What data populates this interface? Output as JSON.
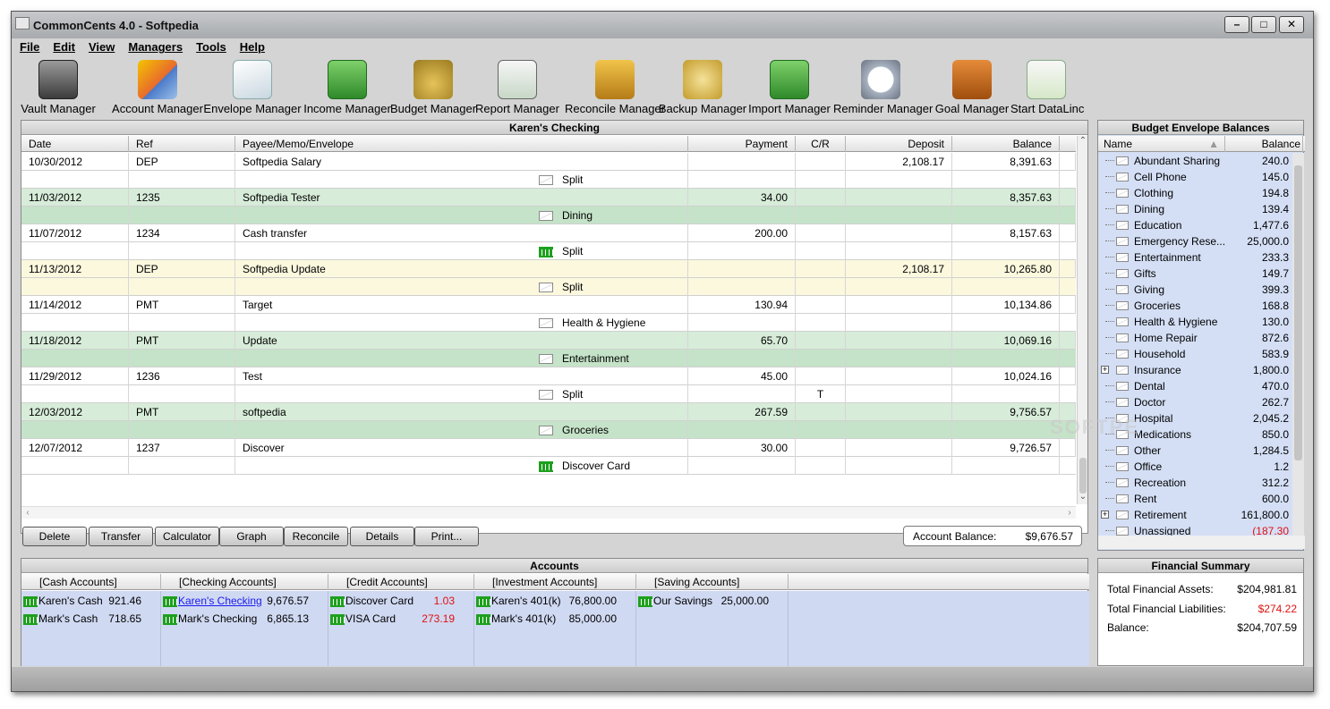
{
  "window": {
    "title": "CommonCents 4.0 - Softpedia"
  },
  "menu": [
    "File",
    "Edit",
    "View",
    "Managers",
    "Tools",
    "Help"
  ],
  "toolbar": [
    {
      "label": "Vault Manager",
      "icon": "vault-icon"
    },
    {
      "label": "Account Manager",
      "icon": "account-icon"
    },
    {
      "label": "Envelope Manager",
      "icon": "envelope-icon"
    },
    {
      "label": "Income Manager",
      "icon": "money-icon"
    },
    {
      "label": "Budget Manager",
      "icon": "money-bag-icon"
    },
    {
      "label": "Report Manager",
      "icon": "report-icon"
    },
    {
      "label": "Reconcile Manager",
      "icon": "scales-icon"
    },
    {
      "label": "Backup Manager",
      "icon": "coins-icon"
    },
    {
      "label": "Import Manager",
      "icon": "import-icon"
    },
    {
      "label": "Reminder Manager",
      "icon": "clock-icon"
    },
    {
      "label": "Goal Manager",
      "icon": "abacus-icon"
    },
    {
      "label": "Start DataLinc",
      "icon": "datalinc-icon"
    }
  ],
  "register": {
    "title": "Karen's Checking",
    "columns": {
      "date": "Date",
      "ref": "Ref",
      "payee": "Payee/Memo/Envelope",
      "payment": "Payment",
      "cr": "C/R",
      "deposit": "Deposit",
      "balance": "Balance"
    },
    "rows": [
      {
        "date": "10/30/2012",
        "ref": "DEP",
        "payee": "Softpedia Salary",
        "payment": "",
        "deposit": "2,108.17",
        "balance": "8,391.63",
        "envelope": "Split",
        "icon": "envelope",
        "cr": "",
        "style": "white"
      },
      {
        "date": "11/03/2012",
        "ref": "1235",
        "payee": "Softpedia Tester",
        "payment": "34.00",
        "deposit": "",
        "balance": "8,357.63",
        "envelope": "Dining",
        "icon": "envelope",
        "cr": "",
        "style": "green"
      },
      {
        "date": "11/07/2012",
        "ref": "1234",
        "payee": "Cash transfer",
        "payment": "200.00",
        "deposit": "",
        "balance": "8,157.63",
        "envelope": "Split",
        "icon": "bank",
        "cr": "",
        "style": "white"
      },
      {
        "date": "11/13/2012",
        "ref": "DEP",
        "payee": "Softpedia Update",
        "payment": "",
        "deposit": "2,108.17",
        "balance": "10,265.80",
        "envelope": "Split",
        "icon": "envelope",
        "cr": "",
        "style": "yellow"
      },
      {
        "date": "11/14/2012",
        "ref": "PMT",
        "payee": "Target",
        "payment": "130.94",
        "deposit": "",
        "balance": "10,134.86",
        "envelope": "Health & Hygiene",
        "icon": "envelope",
        "cr": "",
        "style": "white"
      },
      {
        "date": "11/18/2012",
        "ref": "PMT",
        "payee": "Update",
        "payment": "65.70",
        "deposit": "",
        "balance": "10,069.16",
        "envelope": "Entertainment",
        "icon": "envelope",
        "cr": "",
        "style": "green"
      },
      {
        "date": "11/29/2012",
        "ref": "1236",
        "payee": "Test",
        "payment": "45.00",
        "deposit": "",
        "balance": "10,024.16",
        "envelope": "Split",
        "icon": "envelope",
        "cr": "T",
        "style": "white"
      },
      {
        "date": "12/03/2012",
        "ref": "PMT",
        "payee": "softpedia",
        "payment": "267.59",
        "deposit": "",
        "balance": "9,756.57",
        "envelope": "Groceries",
        "icon": "envelope",
        "cr": "",
        "style": "green"
      },
      {
        "date": "12/07/2012",
        "ref": "1237",
        "payee": "Discover",
        "payment": "30.00",
        "deposit": "",
        "balance": "9,726.57",
        "envelope": "Discover Card",
        "icon": "bank",
        "cr": "",
        "style": "white"
      }
    ],
    "buttons": [
      "Delete",
      "Transfer",
      "Calculator",
      "Graph",
      "Reconcile",
      "Details",
      "Print..."
    ],
    "account_balance_label": "Account Balance:",
    "account_balance_value": "$9,676.57"
  },
  "envelopes": {
    "title": "Budget Envelope Balances",
    "col_name": "Name",
    "col_balance": "Balance",
    "items": [
      {
        "name": "Abundant Sharing",
        "balance": "240.0",
        "neg": false,
        "expand": false
      },
      {
        "name": "Cell Phone",
        "balance": "145.0",
        "neg": false,
        "expand": false
      },
      {
        "name": "Clothing",
        "balance": "194.8",
        "neg": false,
        "expand": false
      },
      {
        "name": "Dining",
        "balance": "139.4",
        "neg": false,
        "expand": false
      },
      {
        "name": "Education",
        "balance": "1,477.6",
        "neg": false,
        "expand": false
      },
      {
        "name": "Emergency Rese...",
        "balance": "25,000.0",
        "neg": false,
        "expand": false
      },
      {
        "name": "Entertainment",
        "balance": "233.3",
        "neg": false,
        "expand": false
      },
      {
        "name": "Gifts",
        "balance": "149.7",
        "neg": false,
        "expand": false
      },
      {
        "name": "Giving",
        "balance": "399.3",
        "neg": false,
        "expand": false
      },
      {
        "name": "Groceries",
        "balance": "168.8",
        "neg": false,
        "expand": false
      },
      {
        "name": "Health & Hygiene",
        "balance": "130.0",
        "neg": false,
        "expand": false
      },
      {
        "name": "Home Repair",
        "balance": "872.6",
        "neg": false,
        "expand": false
      },
      {
        "name": "Household",
        "balance": "583.9",
        "neg": false,
        "expand": false
      },
      {
        "name": "Insurance",
        "balance": "1,800.0",
        "neg": false,
        "expand": true
      },
      {
        "name": "Dental",
        "balance": "470.0",
        "neg": false,
        "expand": false
      },
      {
        "name": "Doctor",
        "balance": "262.7",
        "neg": false,
        "expand": false
      },
      {
        "name": "Hospital",
        "balance": "2,045.2",
        "neg": false,
        "expand": false
      },
      {
        "name": "Medications",
        "balance": "850.0",
        "neg": false,
        "expand": false
      },
      {
        "name": "Other",
        "balance": "1,284.5",
        "neg": false,
        "expand": false
      },
      {
        "name": "Office",
        "balance": "1.2",
        "neg": false,
        "expand": false
      },
      {
        "name": "Recreation",
        "balance": "312.2",
        "neg": false,
        "expand": false
      },
      {
        "name": "Rent",
        "balance": "600.0",
        "neg": false,
        "expand": false
      },
      {
        "name": "Retirement",
        "balance": "161,800.0",
        "neg": false,
        "expand": true
      },
      {
        "name": "Unassigned",
        "balance": "(187.30",
        "neg": true,
        "expand": false
      }
    ]
  },
  "accounts": {
    "title": "Accounts",
    "groups": [
      {
        "header": "[Cash Accounts]",
        "items": [
          {
            "name": "Karen's Cash",
            "value": "921.46",
            "neg": false,
            "link": false
          },
          {
            "name": "Mark's Cash",
            "value": "718.65",
            "neg": false,
            "link": false
          }
        ]
      },
      {
        "header": "[Checking Accounts]",
        "items": [
          {
            "name": "Karen's Checking",
            "value": "9,676.57",
            "neg": false,
            "link": true
          },
          {
            "name": "Mark's Checking",
            "value": "6,865.13",
            "neg": false,
            "link": false
          }
        ]
      },
      {
        "header": "[Credit Accounts]",
        "items": [
          {
            "name": "Discover Card",
            "value": "1.03",
            "neg": true,
            "link": false
          },
          {
            "name": "VISA Card",
            "value": "273.19",
            "neg": true,
            "link": false
          }
        ]
      },
      {
        "header": "[Investment Accounts]",
        "items": [
          {
            "name": "Karen's 401(k)",
            "value": "76,800.00",
            "neg": false,
            "link": false
          },
          {
            "name": "Mark's 401(k)",
            "value": "85,000.00",
            "neg": false,
            "link": false
          }
        ]
      },
      {
        "header": "[Saving Accounts]",
        "items": [
          {
            "name": "Our Savings",
            "value": "25,000.00",
            "neg": false,
            "link": false
          }
        ]
      }
    ]
  },
  "summary": {
    "title": "Financial Summary",
    "rows": [
      {
        "label": "Total Financial Assets:",
        "value": "$204,981.81",
        "neg": false
      },
      {
        "label": "Total Financial Liabilities:",
        "value": "$274.22",
        "neg": true
      },
      {
        "label": "Balance:",
        "value": "$204,707.59",
        "neg": false
      }
    ]
  },
  "watermark": "SOFTPE"
}
